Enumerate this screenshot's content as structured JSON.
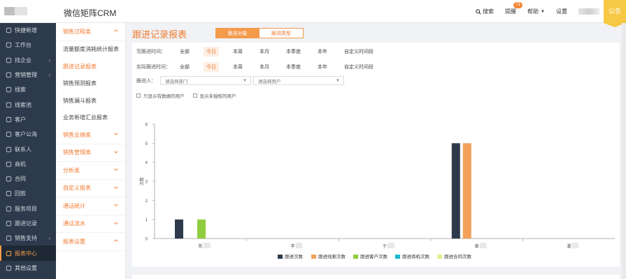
{
  "app": {
    "title": "微信矩阵CRM"
  },
  "top": {
    "search": "搜索",
    "remind": "提醒",
    "remind_badge": "71",
    "help": "帮助",
    "settings": "设置",
    "notice": "公告"
  },
  "leftnav": [
    {
      "label": "快捷新增",
      "arrow": ""
    },
    {
      "label": "工作台",
      "arrow": ""
    },
    {
      "label": "找企业",
      "arrow": "›"
    },
    {
      "label": "营销管理",
      "arrow": "›"
    },
    {
      "label": "线索",
      "arrow": ""
    },
    {
      "label": "线索池",
      "arrow": ""
    },
    {
      "label": "客户",
      "arrow": ""
    },
    {
      "label": "客户公海",
      "arrow": ""
    },
    {
      "label": "联系人",
      "arrow": ""
    },
    {
      "label": "商机",
      "arrow": ""
    },
    {
      "label": "合同",
      "arrow": ""
    },
    {
      "label": "回款",
      "arrow": ""
    },
    {
      "label": "服务项目",
      "arrow": ""
    },
    {
      "label": "跟进记录",
      "arrow": ""
    },
    {
      "label": "销售支持",
      "arrow": "›"
    },
    {
      "label": "报表中心",
      "arrow": ""
    },
    {
      "label": "其他设置",
      "arrow": ""
    }
  ],
  "subnav": {
    "group1": "销售过程类",
    "links": [
      "流量额度消耗统计报表",
      "跟进记录报表",
      "销售预测报表",
      "销售漏斗报表",
      "业务新增汇总报表"
    ],
    "groups": [
      "销售业绩类",
      "销售管理类",
      "分析类",
      "自定义报表",
      "通话统计",
      "通话流水",
      "报表设置"
    ]
  },
  "page": {
    "title": "跟进记录报表",
    "seg_on": "跟进对象",
    "seg_off": "跟进类型"
  },
  "filters": {
    "row1_label": "写跟进时间：",
    "row2_label": "实际跟进时间：",
    "options": [
      "全部",
      "今日",
      "本周",
      "本月",
      "本季度",
      "本年",
      "自定义时间段"
    ],
    "selected": "今日",
    "person_label": "跟进人：",
    "dept_placeholder": "请选择部门",
    "user_placeholder": "请选择用户",
    "chk1": "只显示有数据的用户",
    "chk2": "显示未授权的用户"
  },
  "chart_data": {
    "type": "bar",
    "categories": [
      "陈",
      "李",
      "于",
      "黄",
      "潘"
    ],
    "ylabel": "次数",
    "ylim": [
      0,
      6
    ],
    "yticks": [
      0,
      1,
      2,
      3,
      4,
      5,
      6
    ],
    "series": [
      {
        "name": "跟进次数",
        "color": "#2e3a4c",
        "values": [
          1,
          0,
          0,
          5,
          0
        ]
      },
      {
        "name": "跟进线索次数",
        "color": "#f3a159",
        "values": [
          0,
          0,
          0,
          5,
          0
        ]
      },
      {
        "name": "跟进客户次数",
        "color": "#8fcd3f",
        "values": [
          1,
          0,
          0,
          0,
          0
        ]
      },
      {
        "name": "跟进商机次数",
        "color": "#1db8d0",
        "values": [
          0,
          0,
          0,
          0,
          0
        ]
      },
      {
        "name": "跟进合同次数",
        "color": "#e5ef8f",
        "values": [
          0,
          0,
          0,
          0,
          0
        ]
      }
    ],
    "grid": false,
    "legend": "bottom"
  }
}
